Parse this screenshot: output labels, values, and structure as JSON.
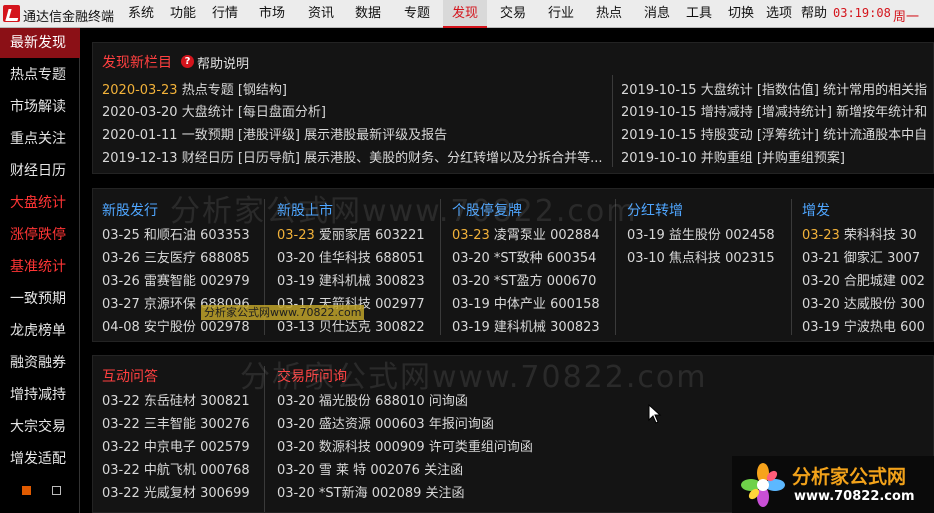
{
  "menubar": {
    "app_title": "通达信金融终端",
    "items": [
      "系统",
      "功能",
      "行情",
      "市场",
      "资讯",
      "数据",
      "专题",
      "发现",
      "交易",
      "行业",
      "热点",
      "消息",
      "工具",
      "切换",
      "选项",
      "帮助"
    ],
    "active": "发现",
    "clock": "03:19:08",
    "weekday": "周一"
  },
  "sidebar": {
    "items": [
      "最新发现",
      "热点专题",
      "市场解读",
      "重点关注",
      "财经日历",
      "大盘统计",
      "涨停跌停",
      "基准统计",
      "一致预期",
      "龙虎榜单",
      "融资融券",
      "增持减持",
      "大宗交易",
      "增发适配"
    ],
    "active": "最新发现",
    "red_items": [
      "大盘统计",
      "涨停跌停",
      "基准统计"
    ]
  },
  "new_section": {
    "title": "发现新栏目",
    "help_label": "帮助说明",
    "left": [
      {
        "date": "2020-03-23",
        "text": "热点专题 [钢结构]",
        "highlight": true
      },
      {
        "date": "2020-03-20",
        "text": "大盘统计 [每日盘面分析]",
        "highlight": false
      },
      {
        "date": "2020-01-11",
        "text": "一致预期 [港股评级]  展示港股最新评级及报告",
        "highlight": false
      },
      {
        "date": "2019-12-13",
        "text": "财经日历 [日历导航]  展示港股、美股的财务、分红转增以及分拆合并等...",
        "highlight": false
      }
    ],
    "right": [
      {
        "date": "2019-10-15",
        "text": "大盘统计 [指数估值]  统计常用的相关指"
      },
      {
        "date": "2019-10-15",
        "text": "增持减持 [增减持统计]  新增按年统计和"
      },
      {
        "date": "2019-10-15",
        "text": "持股变动 [浮筹统计]  统计流通股本中自"
      },
      {
        "date": "2019-10-10",
        "text": "并购重组 [并购重组预案]"
      }
    ]
  },
  "stock_columns": [
    {
      "title": "新股发行",
      "rows": [
        {
          "date": "03-25",
          "name": "和顺石油",
          "code": "603353",
          "hi": false
        },
        {
          "date": "03-26",
          "name": "三友医疗",
          "code": "688085",
          "hi": false
        },
        {
          "date": "03-26",
          "name": "雷赛智能",
          "code": "002979",
          "hi": false
        },
        {
          "date": "03-27",
          "name": "京源环保",
          "code": "688096",
          "hi": false
        },
        {
          "date": "04-08",
          "name": "安宁股份",
          "code": "002978",
          "hi": false
        }
      ]
    },
    {
      "title": "新股上市",
      "rows": [
        {
          "date": "03-23",
          "name": "爱丽家居",
          "code": "603221",
          "hi": true
        },
        {
          "date": "03-20",
          "name": "佳华科技",
          "code": "688051",
          "hi": false
        },
        {
          "date": "03-19",
          "name": "建科机械",
          "code": "300823",
          "hi": false
        },
        {
          "date": "03-17",
          "name": "天箭科技",
          "code": "002977",
          "hi": false
        },
        {
          "date": "03-13",
          "name": "贝仕达克",
          "code": "300822",
          "hi": false
        }
      ]
    },
    {
      "title": "个股停复牌",
      "rows": [
        {
          "date": "03-23",
          "name": "凌霄泵业",
          "code": "002884",
          "hi": true
        },
        {
          "date": "03-20",
          "name": "*ST致种",
          "code": "600354",
          "hi": false
        },
        {
          "date": "03-20",
          "name": "*ST盈方",
          "code": "000670",
          "hi": false
        },
        {
          "date": "03-19",
          "name": "中体产业",
          "code": "600158",
          "hi": false
        },
        {
          "date": "03-19",
          "name": "建科机械",
          "code": "300823",
          "hi": false
        }
      ]
    },
    {
      "title": "分红转增",
      "rows": [
        {
          "date": "03-19",
          "name": "益生股份",
          "code": "002458",
          "hi": false
        },
        {
          "date": "03-10",
          "name": "焦点科技",
          "code": "002315",
          "hi": false
        }
      ]
    },
    {
      "title": "增发",
      "rows": [
        {
          "date": "03-23",
          "name": "荣科科技",
          "code": "30",
          "hi": true
        },
        {
          "date": "03-21",
          "name": "御家汇",
          "code": "3007",
          "hi": false
        },
        {
          "date": "03-20",
          "name": "合肥城建",
          "code": "002",
          "hi": false
        },
        {
          "date": "03-20",
          "name": "达威股份",
          "code": "300",
          "hi": false
        },
        {
          "date": "03-19",
          "name": "宁波热电",
          "code": "600",
          "hi": false
        }
      ]
    }
  ],
  "qa_section": {
    "title": "互动问答",
    "rows": [
      {
        "date": "03-22",
        "name": "东岳硅材",
        "code": "300821"
      },
      {
        "date": "03-22",
        "name": "三丰智能",
        "code": "300276"
      },
      {
        "date": "03-22",
        "name": "中京电子",
        "code": "002579"
      },
      {
        "date": "03-22",
        "name": "中航飞机",
        "code": "000768"
      },
      {
        "date": "03-22",
        "name": "光威复材",
        "code": "300699"
      }
    ]
  },
  "inquiry_section": {
    "title": "交易所问询",
    "rows": [
      {
        "date": "03-20",
        "name": "福光股份",
        "code": "688010",
        "kind": "问询函"
      },
      {
        "date": "03-20",
        "name": "盛达资源",
        "code": "000603",
        "kind": "年报问询函"
      },
      {
        "date": "03-20",
        "name": "数源科技",
        "code": "000909",
        "kind": "许可类重组问询函"
      },
      {
        "date": "03-20",
        "name": "雪 莱 特",
        "code": "002076",
        "kind": "关注函"
      },
      {
        "date": "03-20",
        "name": "*ST新海",
        "code": "002089",
        "kind": "关注函"
      }
    ]
  },
  "watermarks": {
    "text1": "分析家公式网www.70822.com",
    "text2": "分析家公式网www.70822.com",
    "box": "分析家公式网www.70822.com",
    "brand_name": "分析家公式网",
    "brand_url": "www.70822.com"
  },
  "colors": {
    "accent_red": "#d4141c",
    "link_blue": "#4fa6ff",
    "highlight_orange": "#f2b23a",
    "menu_bg": "#ececec"
  }
}
